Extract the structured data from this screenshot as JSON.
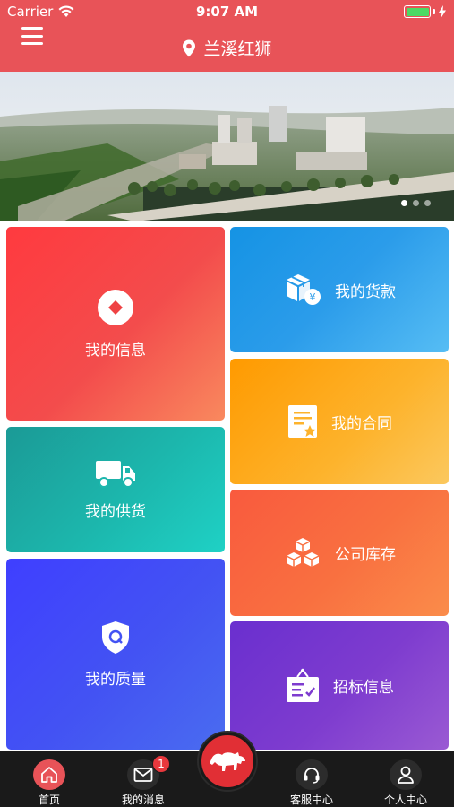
{
  "status_bar": {
    "carrier": "Carrier",
    "time": "9:07 AM"
  },
  "header": {
    "location": "兰溪红狮",
    "background_color": "#e85358",
    "icons": [
      "hamburger-menu-icon",
      "location-pin-icon"
    ]
  },
  "banner": {
    "slide_count": 3,
    "active_slide": 1
  },
  "tiles": [
    {
      "key": "info",
      "label": "我的信息",
      "icon": "diamond-icon",
      "colors": [
        "#ff3a3f",
        "#f9895e"
      ]
    },
    {
      "key": "payment",
      "label": "我的货款",
      "icon": "package-yuan-icon",
      "colors": [
        "#1593e4",
        "#56bdf4"
      ]
    },
    {
      "key": "contract",
      "label": "我的合同",
      "icon": "contract-document-icon",
      "colors": [
        "#ff9a00",
        "#fbc85e"
      ]
    },
    {
      "key": "supply",
      "label": "我的供货",
      "icon": "truck-icon",
      "colors": [
        "#1b9a96",
        "#1fd1c5"
      ]
    },
    {
      "key": "stock",
      "label": "公司库存",
      "icon": "stacked-boxes-icon",
      "colors": [
        "#f95a3e",
        "#fa8c4a"
      ]
    },
    {
      "key": "quality",
      "label": "我的质量",
      "icon": "shield-q-icon",
      "colors": [
        "#3f3fff",
        "#4a6cf0"
      ]
    },
    {
      "key": "bidding",
      "label": "招标信息",
      "icon": "bidding-board-icon",
      "colors": [
        "#6a2fcf",
        "#9a5ad3"
      ]
    }
  ],
  "tabbar": {
    "home": {
      "label": "首页",
      "icon": "home-icon",
      "active": true
    },
    "messages": {
      "label": "我的消息",
      "icon": "envelope-icon",
      "badge": "1"
    },
    "center": {
      "icon": "lion-logo-icon"
    },
    "service": {
      "label": "客服中心",
      "icon": "headset-icon"
    },
    "profile": {
      "label": "个人中心",
      "icon": "person-icon"
    }
  }
}
